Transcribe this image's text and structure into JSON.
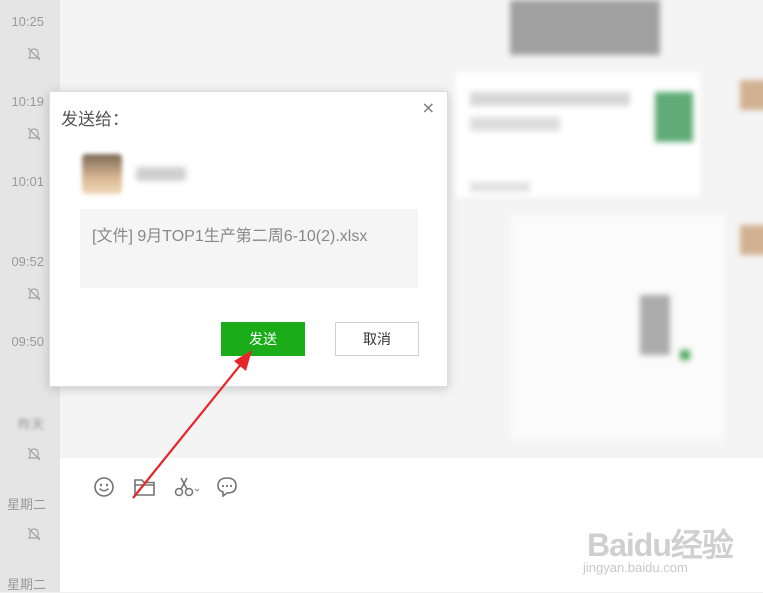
{
  "sidebar": {
    "times": [
      "10:25",
      "10:19",
      "10:01",
      "09:52",
      "09:50",
      "昨天",
      "星期二",
      "星期二"
    ]
  },
  "dialog": {
    "title": "发送给：",
    "close_label": "×",
    "file_text": "[文件] 9月TOP1生产第二周6-10(2).xlsx",
    "send_label": "发送",
    "cancel_label": "取消"
  },
  "colors": {
    "send_button": "#1aad19",
    "arrow": "#e8262a"
  },
  "icons": [
    "emoji-icon",
    "folder-icon",
    "scissors-icon",
    "chat-bubble-icon"
  ],
  "watermark": {
    "logo": "Baidu经验",
    "sub": "jingyan.baidu.com"
  }
}
